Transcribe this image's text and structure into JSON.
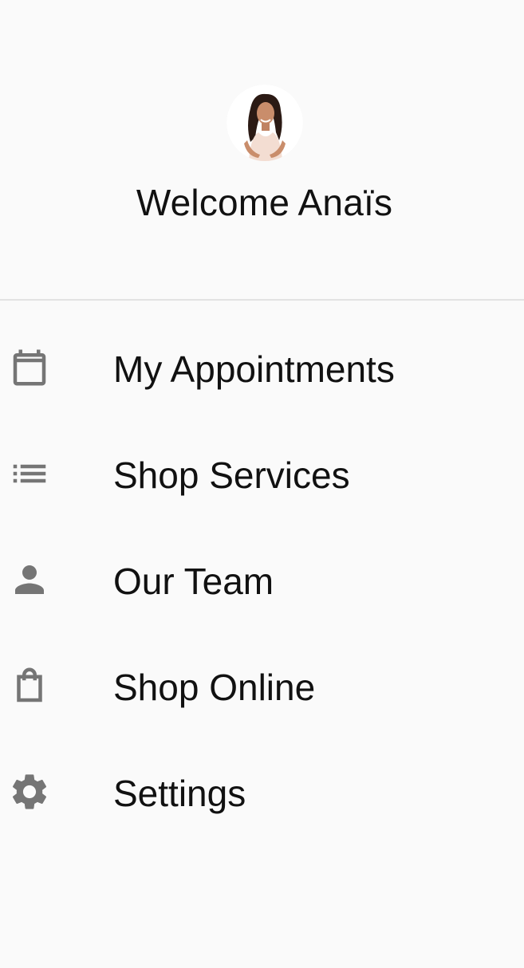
{
  "header": {
    "welcome_text": "Welcome Anaïs",
    "avatar_alt": "profile-photo"
  },
  "menu": {
    "items": [
      {
        "label": "My Appointments",
        "icon": "calendar-icon"
      },
      {
        "label": "Shop Services",
        "icon": "list-icon"
      },
      {
        "label": "Our Team",
        "icon": "person-icon"
      },
      {
        "label": "Shop Online",
        "icon": "shopping-bag-icon"
      },
      {
        "label": "Settings",
        "icon": "gear-icon"
      }
    ]
  },
  "colors": {
    "background": "#fafafa",
    "text": "#111111",
    "icon": "#757575",
    "divider": "#e2e2e2"
  }
}
